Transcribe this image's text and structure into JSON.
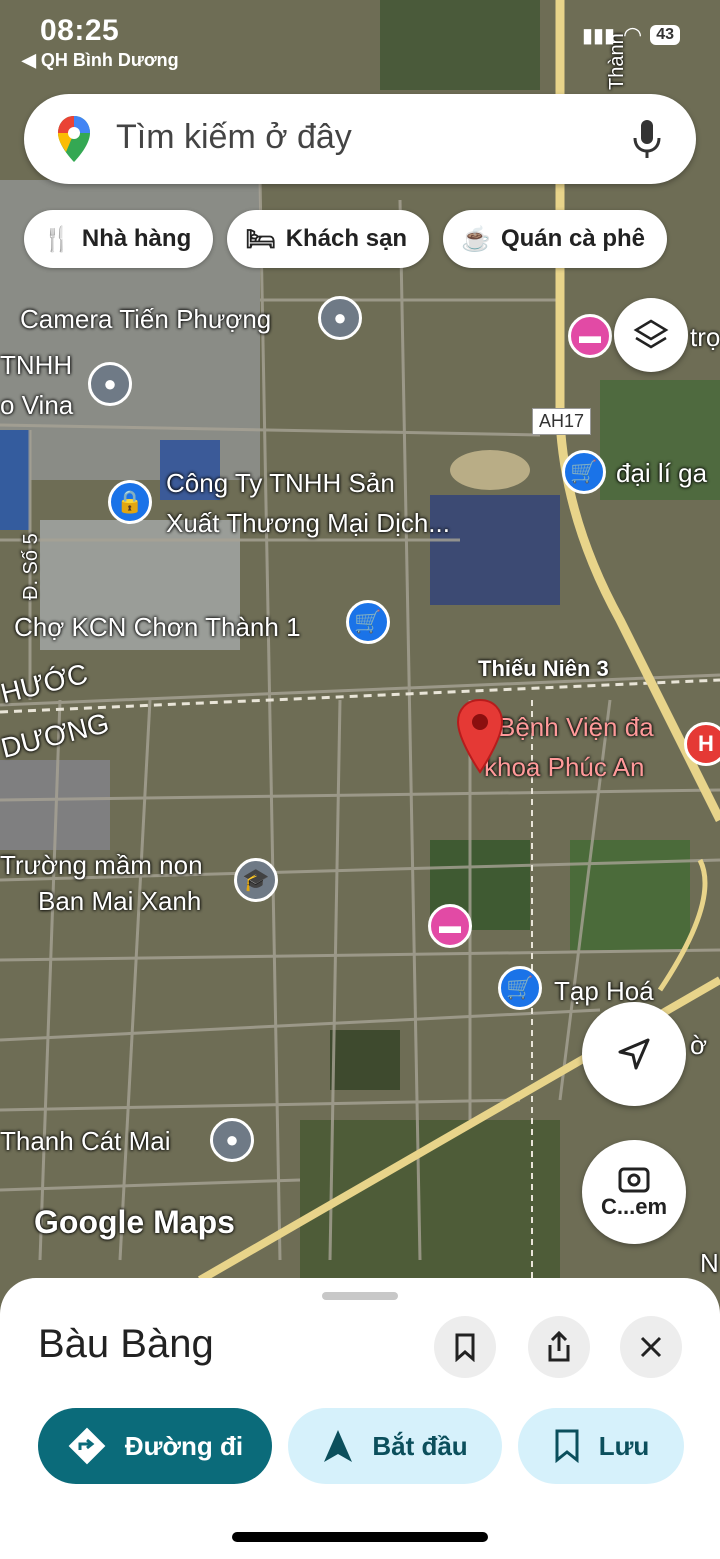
{
  "status_bar": {
    "time": "08:25",
    "back_app": "◀ QH Bình Dương",
    "battery": "43"
  },
  "search": {
    "placeholder": "Tìm kiếm ở đây"
  },
  "chips": [
    {
      "label": "Nhà hàng",
      "icon": "fork-knife-icon"
    },
    {
      "label": "Khách sạn",
      "icon": "bed-icon"
    },
    {
      "label": "Quán cà phê",
      "icon": "coffee-cup-icon"
    }
  ],
  "map": {
    "labels": {
      "camera": "Camera Tiến Phượng",
      "tnhh": "TNHH",
      "vina": "o Vina",
      "congty1": "Công Ty TNHH Sản",
      "congty2": "Xuất Thương Mại Dịch...",
      "daily": "đại lí ga",
      "tro": "trọ",
      "cho": "Chợ KCN Chơn Thành 1",
      "ds5": "Đ. Số 5",
      "thieunien": "Thiếu Niên 3",
      "benhvien1": "Bệnh Viện đa",
      "benhvien2": "khoa Phúc An",
      "phuoc": "HƯỚC",
      "duong": "DƯƠNG",
      "truong1": "Trường mầm non",
      "truong2": "Ban Mai Xanh",
      "taphoa": "Tạp Hoá",
      "thanhcat": "Thanh Cát Mai",
      "ah17": "AH17",
      "road_top": "Thành",
      "google": "Google Maps",
      "edge_o": "ờ",
      "edge_n": "N"
    },
    "camera_button_label": "C...em"
  },
  "sheet": {
    "place_name": "Bàu Bàng",
    "actions": [
      {
        "label": "Đường đi",
        "icon": "directions-icon"
      },
      {
        "label": "Bắt đầu",
        "icon": "navigation-arrow-icon"
      },
      {
        "label": "Lưu",
        "icon": "bookmark-icon"
      }
    ]
  },
  "colors": {
    "accent": "#0b6b7a",
    "chip_light": "#d6f1fb",
    "pin_red": "#e53935",
    "poi_blue": "#1a73e8",
    "poi_gray": "#6f7a86",
    "poi_pink": "#e24aa5"
  }
}
